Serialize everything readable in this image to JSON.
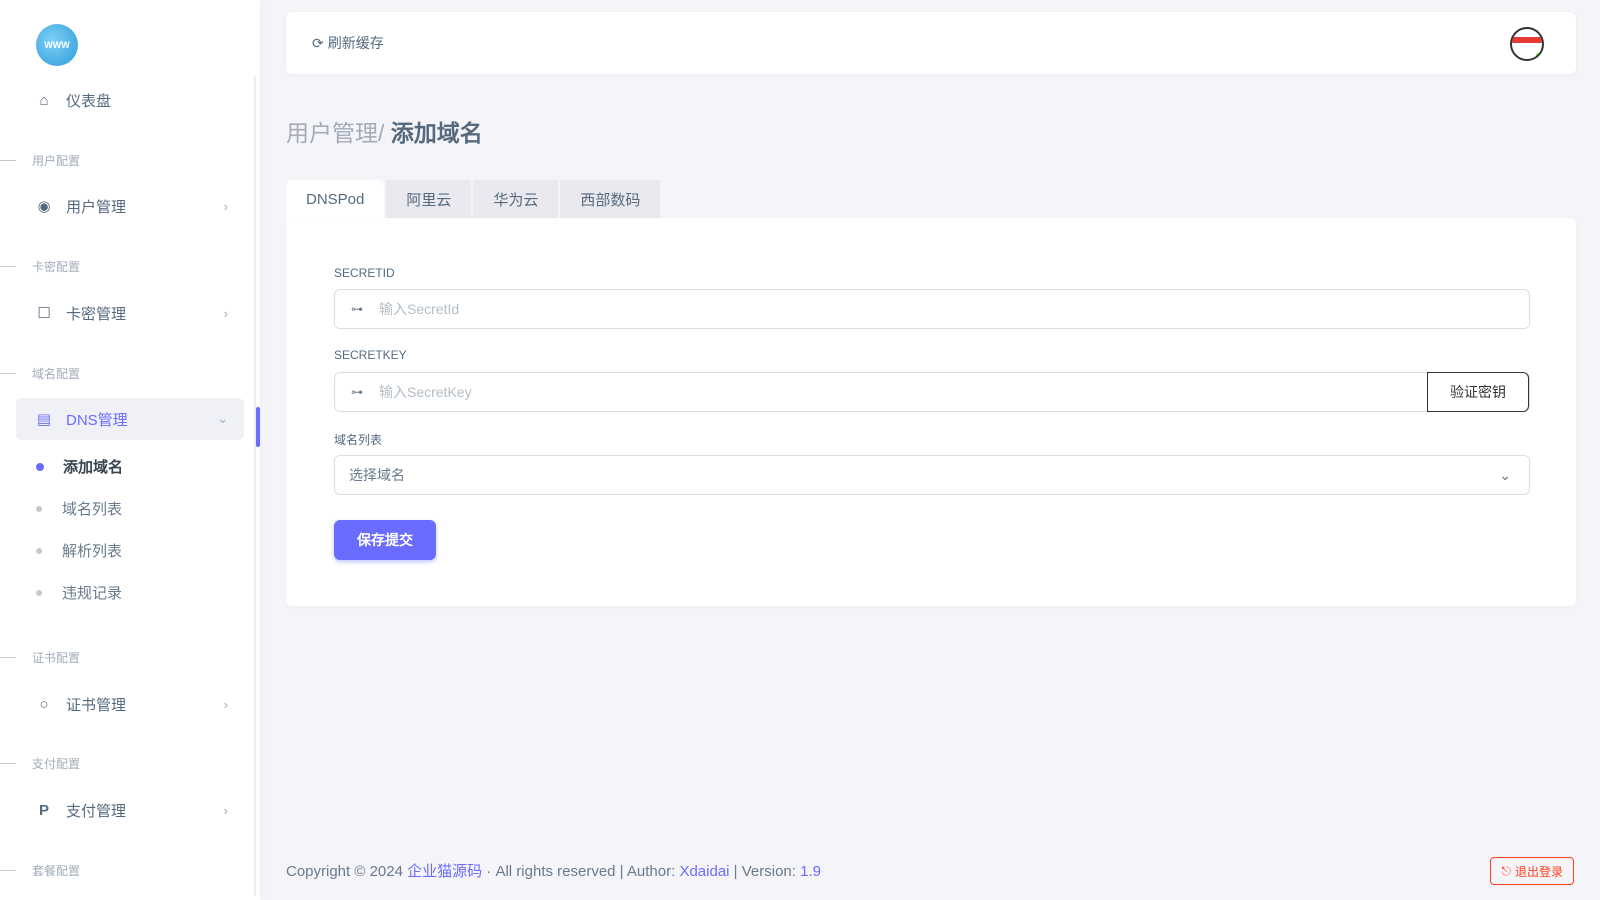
{
  "sidebar": {
    "logo_text": "WWW",
    "dashboard": "仪表盘",
    "sections": [
      "用户配置",
      "卡密配置",
      "域名配置",
      "证书配置",
      "支付配置",
      "套餐配置"
    ],
    "user_mgmt": "用户管理",
    "card_mgmt": "卡密管理",
    "dns_mgmt": "DNS管理",
    "dns_sub": [
      "添加域名",
      "域名列表",
      "解析列表",
      "违规记录"
    ],
    "cert_mgmt": "证书管理",
    "pay_mgmt": "支付管理"
  },
  "navbar": {
    "refresh": "刷新缓存"
  },
  "breadcrumb": {
    "parent": "用户管理/ ",
    "current": "添加域名"
  },
  "tabs": [
    "DNSPod",
    "阿里云",
    "华为云",
    "西部数码"
  ],
  "form": {
    "secretid_label": "SECRETID",
    "secretid_placeholder": "输入SecretId",
    "secretkey_label": "SECRETKEY",
    "secretkey_placeholder": "输入SecretKey",
    "verify_button": "验证密钥",
    "domain_label": "域名列表",
    "domain_select": "选择域名",
    "save_button": "保存提交"
  },
  "footer": {
    "copyright": "Copyright © 2024 ",
    "company": "企业猫源码",
    "rights": " · All rights reserved | Author: ",
    "author": "Xdaidai",
    "version_label": " | Version: ",
    "version": "1.9",
    "logout": "退出登录"
  },
  "colors": {
    "accent": "#696cff",
    "danger": "#ff3e1d"
  }
}
